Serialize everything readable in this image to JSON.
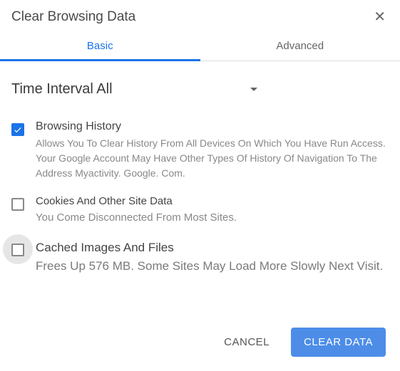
{
  "dialog": {
    "title": "Clear Browsing Data"
  },
  "tabs": {
    "basic": "Basic",
    "advanced": "Advanced"
  },
  "dropdown": {
    "label": "Time Interval All"
  },
  "options": [
    {
      "title": "Browsing History",
      "desc": "Allows You To Clear History From All Devices On Which You Have Run Access. Your Google Account May Have Other Types Of History Of Navigation To The Address Myactivity. Google. Com."
    },
    {
      "title": "Cookies And Other Site Data",
      "desc": "You Come Disconnected From Most Sites."
    },
    {
      "title": "Cached Images And Files",
      "desc": "Frees Up 576 MB. Some Sites May Load More Slowly Next Visit."
    }
  ],
  "buttons": {
    "cancel": "CANCEL",
    "clear": "CLEAR DATA"
  }
}
